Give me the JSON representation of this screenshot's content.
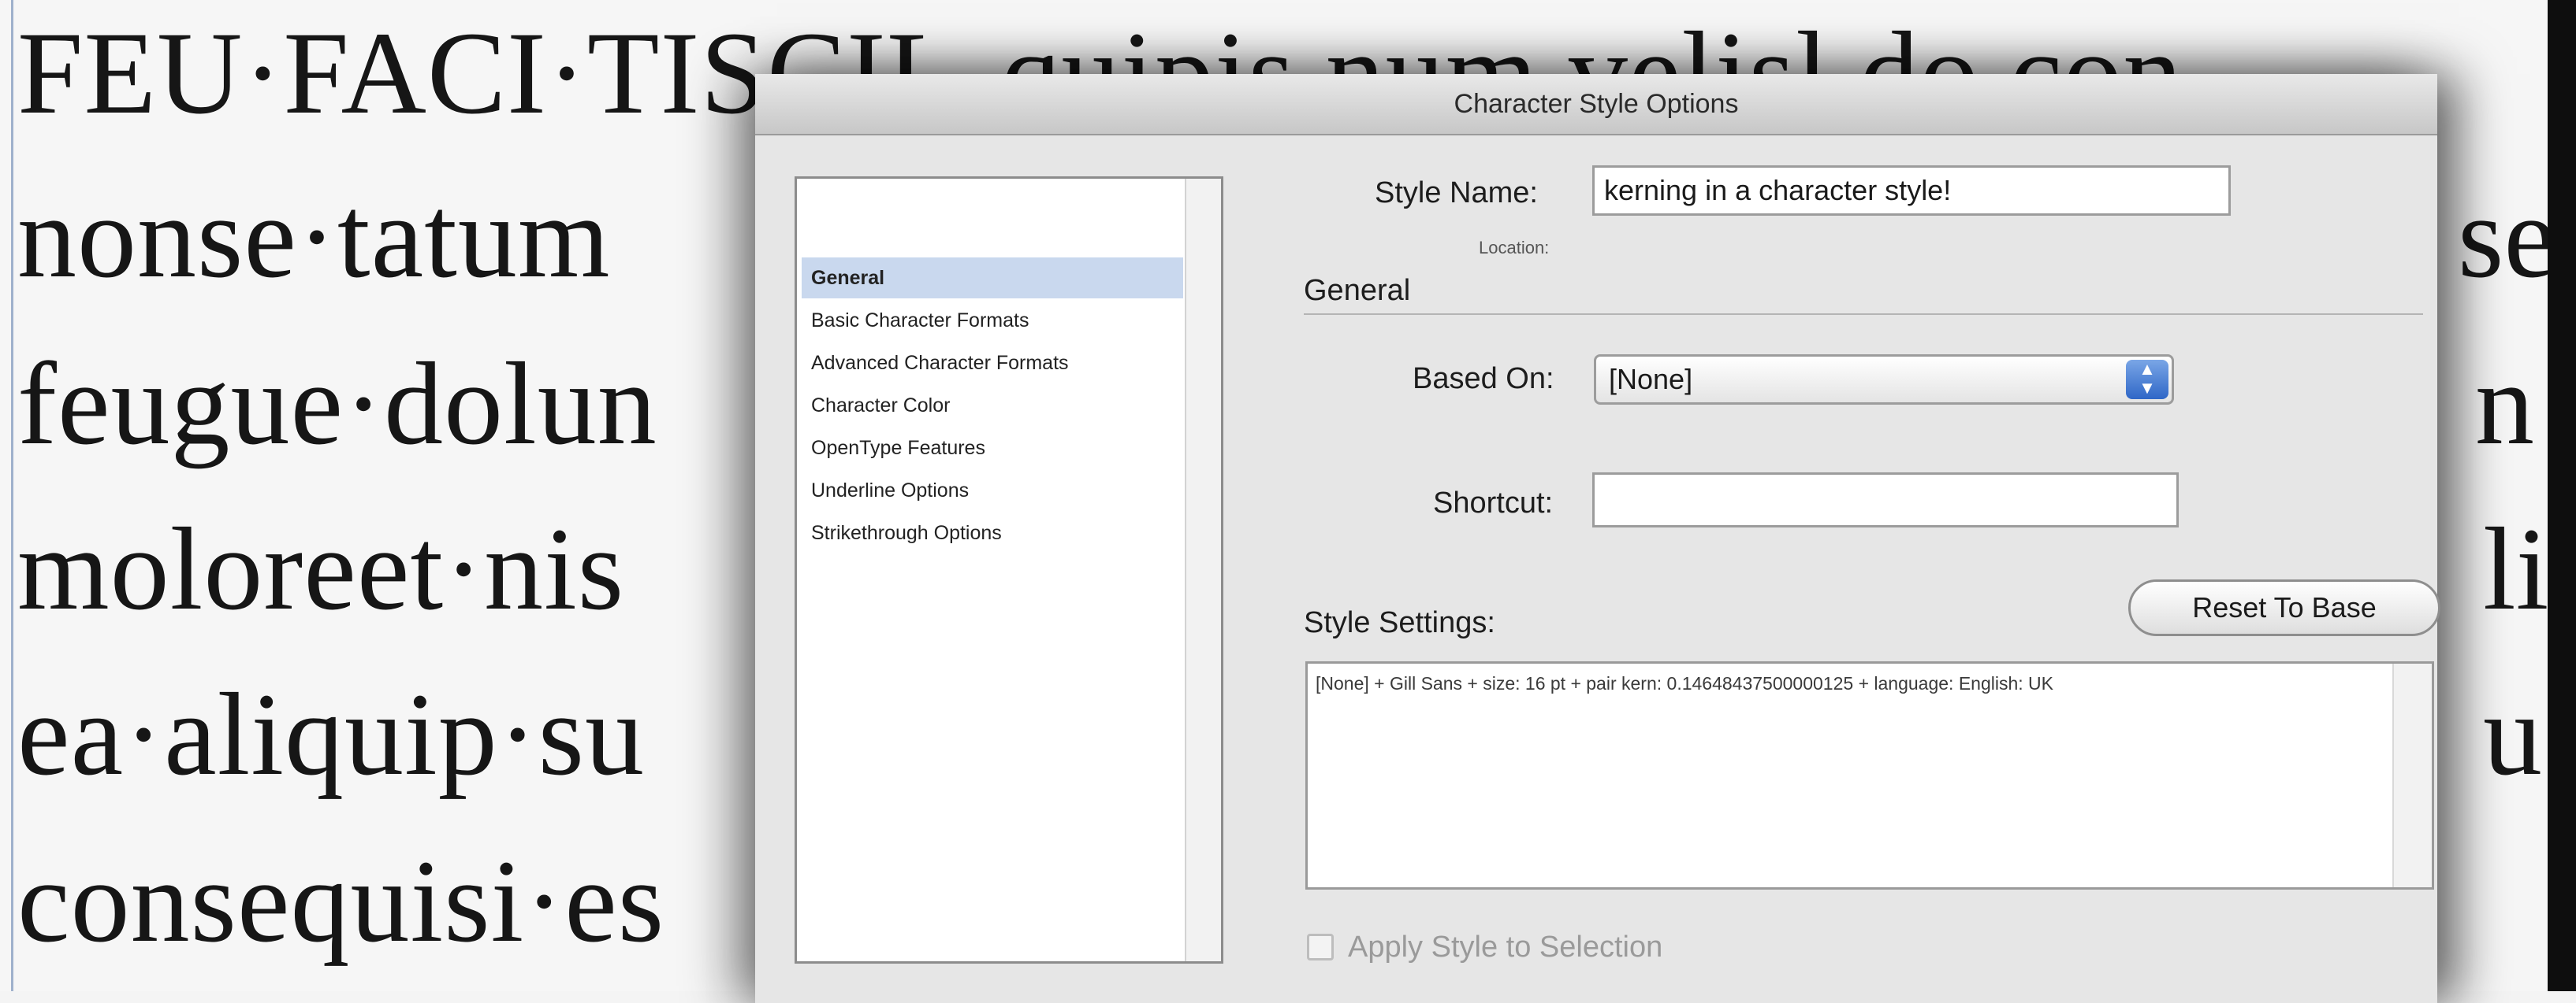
{
  "document": {
    "lines": [
      "FEU·FACI·TISCIL",
      "nonse·tatum",
      "feugue·dolun",
      "moloreet·nis",
      "ea·aliquip·su",
      "consequisi·es"
    ],
    "line1_tail": "quipis num velisl do con",
    "right_fragments": [
      "se",
      "n",
      "li",
      "u"
    ]
  },
  "dialog": {
    "title": "Character Style Options",
    "categories": [
      "General",
      "Basic Character Formats",
      "Advanced Character Formats",
      "Character Color",
      "OpenType Features",
      "Underline Options",
      "Strikethrough Options"
    ],
    "selected_category": "General",
    "style_name_label": "Style Name:",
    "style_name_value": "kerning in a character style!",
    "location_label": "Location:",
    "section_title": "General",
    "based_on_label": "Based On:",
    "based_on_value": "[None]",
    "shortcut_label": "Shortcut:",
    "shortcut_value": "",
    "reset_button": "Reset To Base",
    "style_settings_label": "Style Settings:",
    "style_settings_text": "[None] + Gill Sans + size: 16 pt + pair kern: 0.14648437500000125 + language: English: UK",
    "apply_label": "Apply Style to Selection",
    "apply_checked": false
  },
  "colors": {
    "selection_highlight": "#c9d8ee",
    "select_stepper": "#2f67c7",
    "frame_edge": "#9fb1cc"
  }
}
